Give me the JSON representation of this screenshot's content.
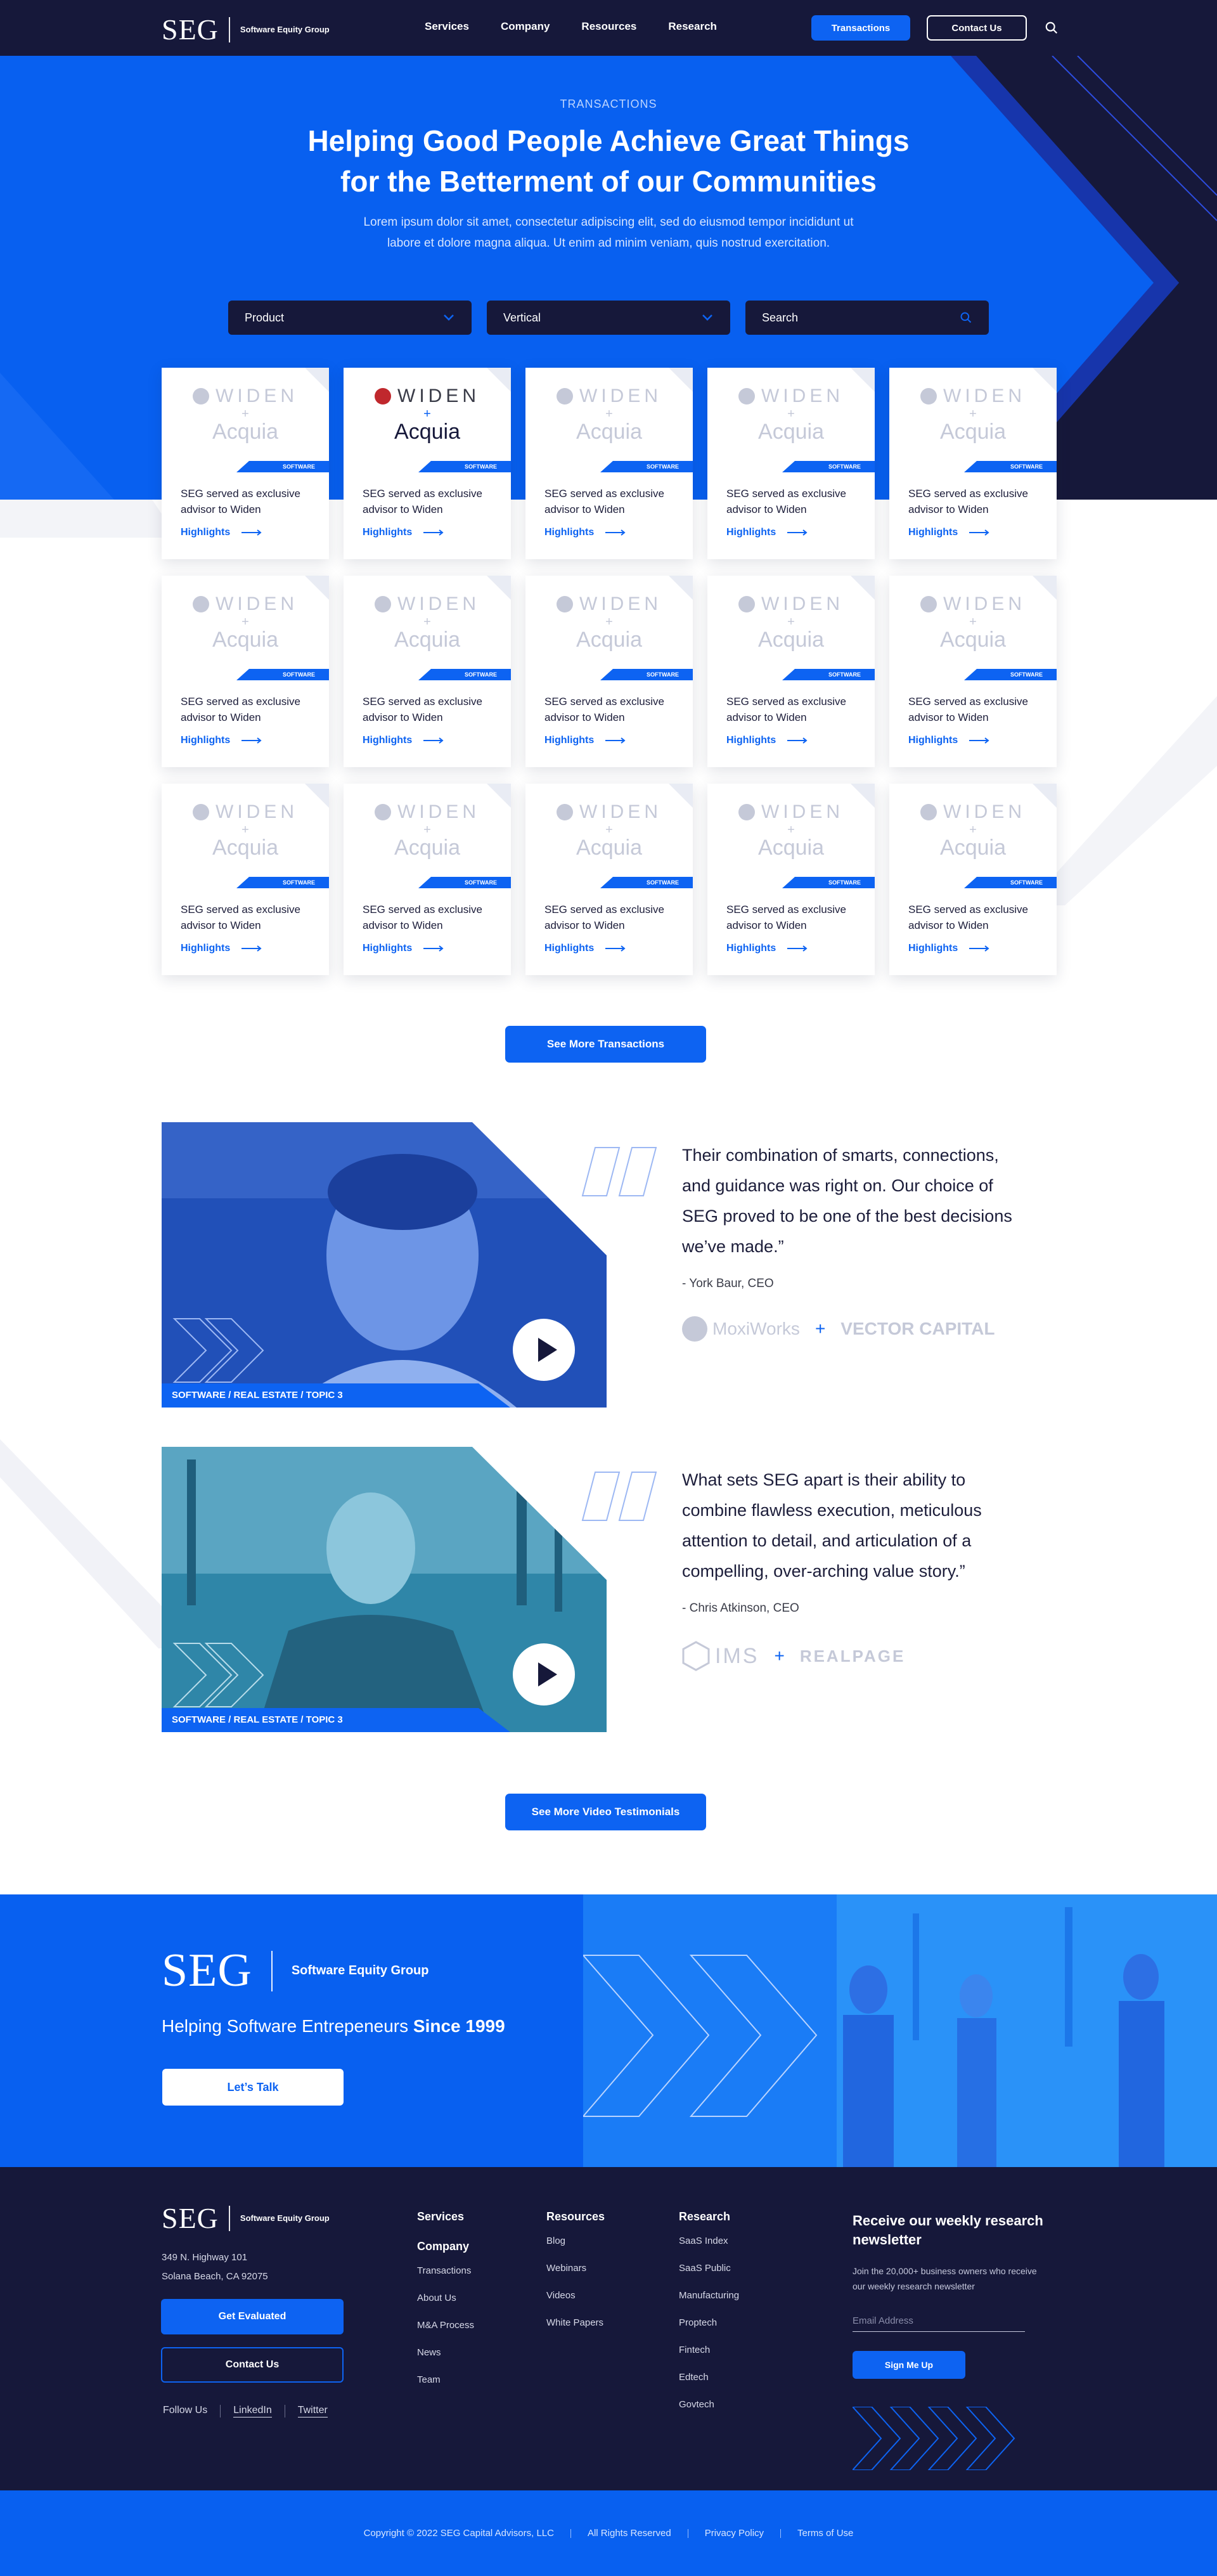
{
  "header": {
    "logo_mark": "SEG",
    "logo_name": "Software Equity Group",
    "nav": [
      "Services",
      "Company",
      "Resources",
      "Research"
    ],
    "transactions_btn": "Transactions",
    "contact_btn": "Contact Us",
    "search_icon": "search-icon"
  },
  "hero": {
    "eyebrow": "TRANSACTIONS",
    "title_line1": "Helping Good People Achieve Great Things",
    "title_line2": "for the Betterment of our Communities",
    "description": "Lorem ipsum dolor sit amet, consectetur adipiscing elit, sed do eiusmod tempor incididunt ut labore et dolore magna aliqua. Ut enim ad minim veniam, quis nostrud exercitation.",
    "filters": {
      "product": "Product",
      "vertical": "Vertical",
      "search_placeholder": "Search"
    }
  },
  "cards": {
    "logo_top": "WIDEN",
    "logo_plus": "+",
    "logo_bottom": "Acquia",
    "tag": "SOFTWARE",
    "text": "SEG served as exclusive advisor to Widen",
    "link": "Highlights",
    "active_index": 1
  },
  "see_more_transactions": "See More Transactions",
  "testimonials": [
    {
      "tags": "SOFTWARE   /   REAL ESTATE   /   TOPIC 3",
      "quote": "Their combination of smarts, connections, and guidance was right on. Our choice of SEG proved to be one of the best decisions we’ve made.”",
      "author": "- York Baur, CEO",
      "brand_a": "MoxiWorks",
      "brand_b": "VECTOR CAPITAL"
    },
    {
      "tags": "SOFTWARE   /   REAL ESTATE   /   TOPIC 3",
      "quote": "What sets SEG apart is their ability to combine flawless execution, meticulous attention to detail, and articulation of a compelling, over-arching value story.”",
      "author": "- Chris Atkinson, CEO",
      "brand_a": "IMS",
      "brand_b": "REALPAGE"
    }
  ],
  "see_more_videos": "See More Video Testimonials",
  "band": {
    "logo_mark": "SEG",
    "logo_name": "Software Equity Group",
    "tagline_prefix": "Helping Software Entrepeneurs ",
    "tagline_bold": "Since 1999",
    "button": "Let’s Talk"
  },
  "footer": {
    "logo_mark": "SEG",
    "logo_name": "Software Equity Group",
    "address_line1": "349 N. Highway 101",
    "address_line2": "Solana Beach, CA 92075",
    "get_evaluated": "Get Evaluated",
    "contact_us": "Contact Us",
    "follow_us": "Follow Us",
    "linkedin": "LinkedIn",
    "twitter": "Twitter",
    "col1": {
      "title1": "Services",
      "title2": "Company",
      "items": [
        "Transactions",
        "About Us",
        "M&A Process",
        "News",
        "Team"
      ]
    },
    "col2": {
      "title": "Resources",
      "items": [
        "Blog",
        "Webinars",
        "Videos",
        "White Papers"
      ]
    },
    "col3": {
      "title": "Research",
      "items": [
        "SaaS Index",
        "SaaS Public",
        "Manufacturing",
        "Proptech",
        "Fintech",
        "Edtech",
        "Govtech"
      ]
    },
    "newsletter": {
      "title": "Receive our weekly research newsletter",
      "desc": "Join the 20,000+ business owners who receive our weekly research newsletter",
      "email_placeholder": "Email Address",
      "button": "Sign Me Up"
    }
  },
  "copyright": {
    "text": "Copyright © 2022 SEG Capital Advisors, LLC",
    "rights": "All Rights Reserved",
    "privacy": "Privacy Policy",
    "terms": "Terms of Use"
  },
  "colors": {
    "primary_blue": "#0d63f2",
    "hero_blue": "#0860f0",
    "navy": "#16183a"
  }
}
